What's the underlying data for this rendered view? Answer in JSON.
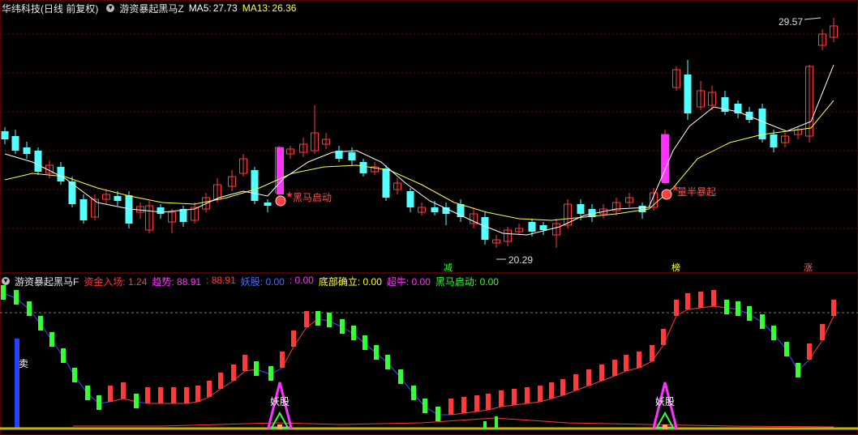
{
  "main_panel": {
    "stock_name": "华纬科技",
    "period_label": "(日线 前复权)",
    "indicator_name": "游资暴起黑马Z",
    "ma5_label": "MA5:",
    "ma5_value": "27.73",
    "ma13_label": "MA13:",
    "ma13_value": "26.36",
    "high_price_label": "29.57",
    "low_price_label": "20.29",
    "signal_start": "黑马启动",
    "signal_surge": "量半暴起",
    "markers": [
      "减",
      "榜",
      "涨"
    ]
  },
  "sub_panel": {
    "indicator_name": "游资暴起黑马F",
    "fields": [
      {
        "label": "资金入场:",
        "value": "1.24",
        "color": "#ff3a3a"
      },
      {
        "label": "趋势:",
        "value": "88.91",
        "color": "#ff33ff"
      },
      {
        "label": ":",
        "value": "88.91",
        "color": "#ff3a3a"
      },
      {
        "label": "妖股:",
        "value": "0.00",
        "color": "#4a6bff"
      },
      {
        "label": ":",
        "value": "0.00",
        "color": "#ff33ff"
      },
      {
        "label": "底部确立:",
        "value": "0.00",
        "color": "#ffff44"
      },
      {
        "label": "超牛:",
        "value": "0.00",
        "color": "#ff33ff"
      },
      {
        "label": "黑马启动:",
        "value": "0.00",
        "color": "#33ff33"
      }
    ],
    "sell_label": "卖",
    "demon_label": "妖股"
  },
  "colors": {
    "up": "#ff3a3a",
    "down": "#54ffff",
    "ma5": "#ffffff",
    "ma13": "#ffff44",
    "grid": "#7a0000",
    "magenta": "#ff33ff",
    "green": "#33ff33"
  }
}
